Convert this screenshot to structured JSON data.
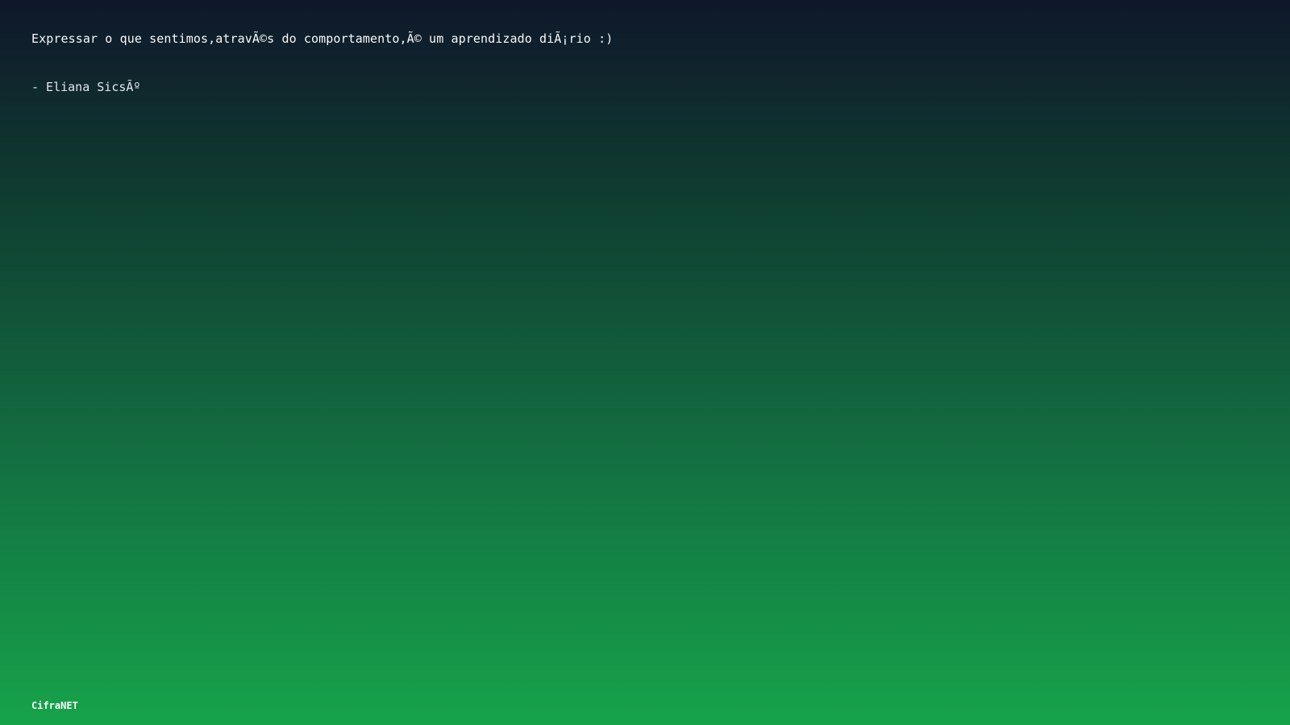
{
  "quote": {
    "text": "Expressar o que sentimos,atravÃ©s do comportamento,Ã© um aprendizado diÃ¡rio :)",
    "author": "- Eliana SicsÃº"
  },
  "footer": {
    "brand": "CifraNET"
  },
  "colors": {
    "gradient_top": "#0f172a",
    "gradient_bottom": "#16a34a",
    "text": "#f8fafc"
  }
}
